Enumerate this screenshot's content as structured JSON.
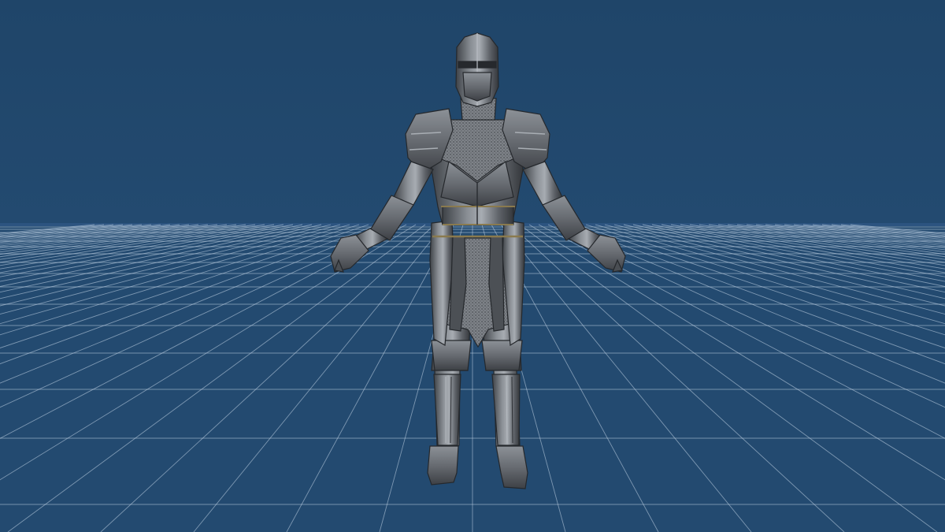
{
  "viewport": {
    "background_color": "#234a70",
    "grid_line_color": "#c8d8ea",
    "horizon_color": "#2c5480"
  },
  "model": {
    "subject": "knight-armor",
    "pose": "a-pose",
    "metal_color": "#6e7278",
    "metal_highlight": "#a9aeb4",
    "metal_shadow": "#3a3d42",
    "trim_color": "#8a7a4e",
    "chainmail_color": "#7b7f84"
  }
}
